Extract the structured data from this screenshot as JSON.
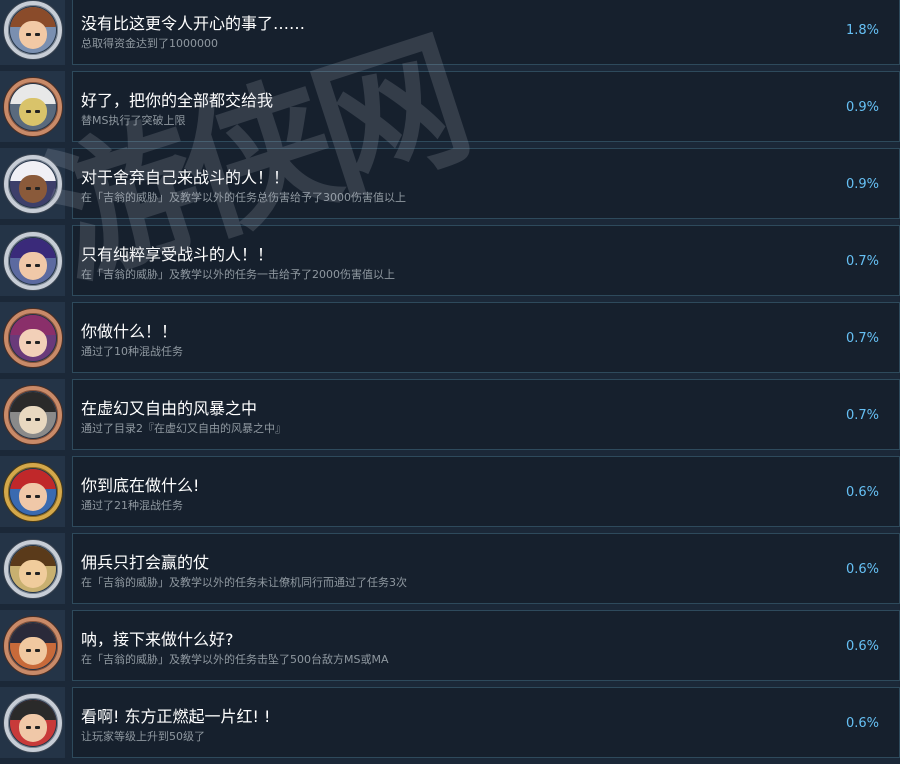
{
  "watermark": "游侠网",
  "achievements": [
    {
      "title": "没有比这更令人开心的事了……",
      "desc": "总取得资金达到了1000000",
      "pct": "1.8%",
      "medal": "silver",
      "icon": "amuro-portrait-icon",
      "hair": "#8a4b2a",
      "skin": "#f2c9a5",
      "bg": "#7a8fb0"
    },
    {
      "title": "好了，把你的全部都交给我",
      "desc": "替MS执行了突破上限",
      "pct": "0.9%",
      "medal": "bronze",
      "icon": "mobile-suit-icon",
      "hair": "#e8e8e8",
      "skin": "#d9c36a",
      "bg": "#5a6a7d"
    },
    {
      "title": "对于舍弃自己来战斗的人！！",
      "desc": "在「吉翁的威胁」及教学以外的任务总伤害给予了3000伤害值以上",
      "pct": "0.9%",
      "medal": "silver",
      "icon": "white-hair-portrait-icon",
      "hair": "#f0f0f5",
      "skin": "#8a5a3a",
      "bg": "#3d3f6a"
    },
    {
      "title": "只有纯粹享受战斗的人！！",
      "desc": "在「吉翁的威胁」及教学以外的任务一击给予了2000伤害值以上",
      "pct": "0.7%",
      "medal": "silver",
      "icon": "shouting-portrait-icon",
      "hair": "#3a2a7a",
      "skin": "#f0c8a8",
      "bg": "#5c6aa0"
    },
    {
      "title": "你做什么！！",
      "desc": "通过了10种混战任务",
      "pct": "0.7%",
      "medal": "bronze",
      "icon": "helmet-portrait-icon",
      "hair": "#8a2f6a",
      "skin": "#f2d0b8",
      "bg": "#6a3a7a"
    },
    {
      "title": "在虚幻又自由的风暴之中",
      "desc": "通过了目录2『在虚幻又自由的风暴之中』",
      "pct": "0.7%",
      "medal": "bronze",
      "icon": "group-portrait-icon",
      "hair": "#2a2a2a",
      "skin": "#e8d8c0",
      "bg": "#8a8a8a"
    },
    {
      "title": "你到底在做什么!",
      "desc": "通过了21种混战任务",
      "pct": "0.6%",
      "medal": "gold",
      "icon": "red-helmet-portrait-icon",
      "hair": "#c0282a",
      "skin": "#f0c8a8",
      "bg": "#3a6ab0"
    },
    {
      "title": "佣兵只打会赢的仗",
      "desc": "在「吉翁的威胁」及教学以外的任务未让僚机同行而通过了任务3次",
      "pct": "0.6%",
      "medal": "silver",
      "icon": "glasses-portrait-icon",
      "hair": "#5a3a1a",
      "skin": "#f0cc9c",
      "bg": "#c8b070"
    },
    {
      "title": "呐，接下来做什么好?",
      "desc": "在「吉翁的威胁」及教学以外的任务击坠了500台敌方MS或MA",
      "pct": "0.6%",
      "medal": "bronze",
      "icon": "dark-hair-portrait-icon",
      "hair": "#2a2a3a",
      "skin": "#f0c8a0",
      "bg": "#c86a3a"
    },
    {
      "title": "看啊! 东方正燃起一片红! !",
      "desc": "让玩家等级上升到50级了",
      "pct": "0.6%",
      "medal": "silver",
      "icon": "headband-portrait-icon",
      "hair": "#2a2a2a",
      "skin": "#f0c8a8",
      "bg": "#c83a3a"
    }
  ]
}
